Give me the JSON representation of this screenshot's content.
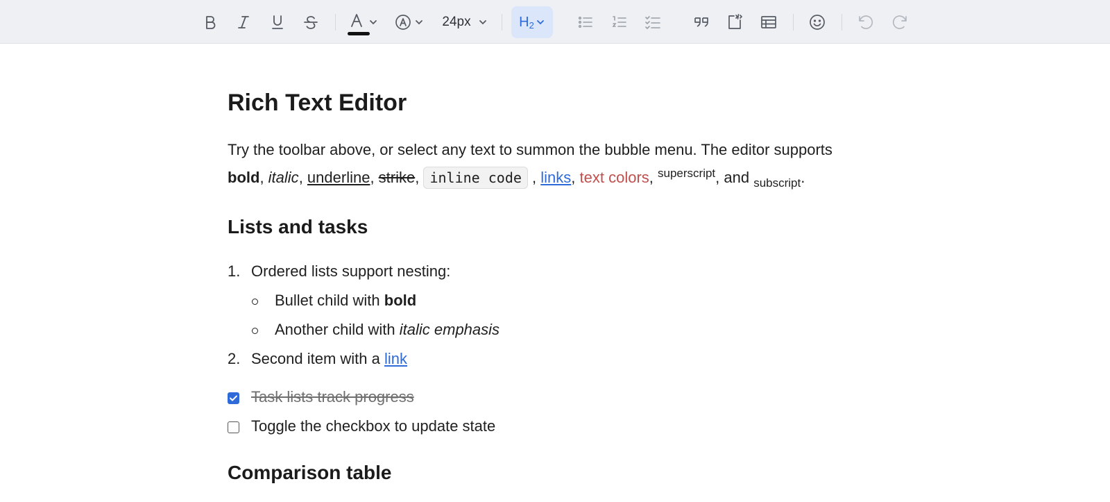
{
  "toolbar": {
    "font_size": "24px",
    "heading": {
      "letter": "H",
      "level": "2"
    },
    "text_color": "#111111",
    "icons": [
      "bold-icon",
      "italic-icon",
      "underline-icon",
      "strike-icon",
      "text-color-icon",
      "highlight-icon",
      "font-size-dropdown",
      "heading-dropdown",
      "bullet-list-icon",
      "ordered-list-icon",
      "task-list-icon",
      "quote-icon",
      "code-block-icon",
      "table-icon",
      "emoji-icon",
      "undo-icon",
      "redo-icon"
    ]
  },
  "doc": {
    "title": "Rich Text Editor",
    "intro": {
      "t1": "Try the toolbar above, or select any text to summon the bubble menu. The editor supports",
      "bold": "bold",
      "c1": ", ",
      "italic": "italic",
      "c2": ", ",
      "underline": "underline",
      "c3": ", ",
      "strike": "strike",
      "c4": ", ",
      "code": "inline code",
      "c5": " , ",
      "links": "links",
      "c6": ", ",
      "text_colors": "text colors",
      "c7": ", ",
      "superscript": "superscript",
      "c8": ", and ",
      "subscript": "subscript",
      "c9": "."
    },
    "lists_heading": "Lists and tasks",
    "ordered": {
      "item1_num": "1.",
      "item1": "Ordered lists support nesting:",
      "child1_text": "Bullet child with ",
      "child1_bold": "bold",
      "child2_text": "Another child with ",
      "child2_italic": "italic emphasis",
      "item2_num": "2.",
      "item2_text": "Second item with a ",
      "item2_link": "link"
    },
    "tasks": [
      {
        "label": "Task lists track progress",
        "checked": true
      },
      {
        "label": "Toggle the checkbox to update state",
        "checked": false
      }
    ],
    "table_heading": "Comparison table"
  }
}
